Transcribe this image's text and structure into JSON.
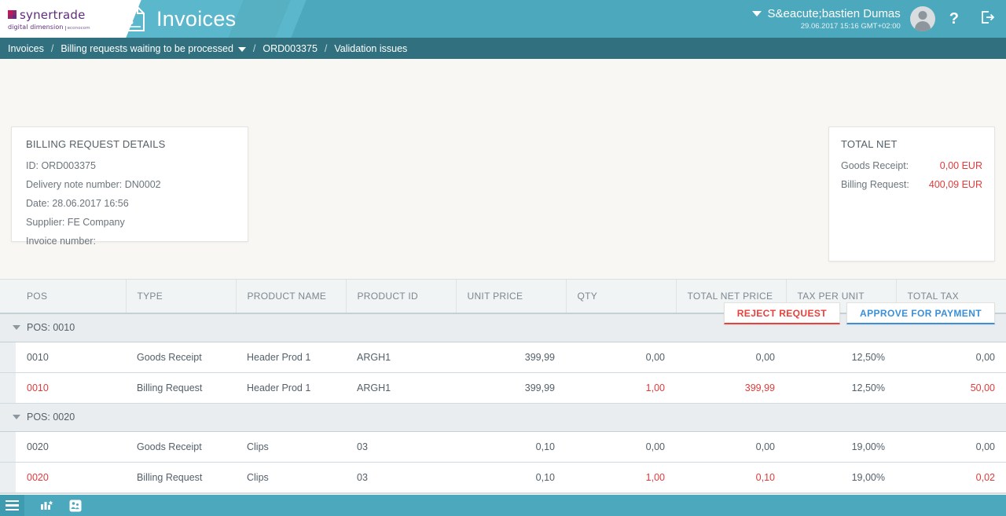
{
  "header": {
    "logo": {
      "word": "synertrade",
      "sub": "digital dimension",
      "eco": "econocom"
    },
    "title": "Invoices",
    "invoice_icon": "invoice-document-icon",
    "user_name": "S&eacute;bastien Dumas",
    "user_time": "29.06.2017 15:16 GMT+02:00",
    "help_label": "?",
    "avatar_icon": "user-avatar-icon",
    "logout_icon": "logout-icon",
    "caret_icon": "chevron-down-icon"
  },
  "breadcrumb": {
    "items": [
      {
        "label": "Invoices",
        "has_caret": false
      },
      {
        "label": "Billing requests waiting to be processed",
        "has_caret": true
      },
      {
        "label": "ORD003375",
        "has_caret": false
      },
      {
        "label": "Validation issues",
        "has_caret": false
      }
    ],
    "separator": "/"
  },
  "details": {
    "title": "BILLING REQUEST DETAILS",
    "lines": [
      "ID: ORD003375",
      "Delivery note number: DN0002",
      "Date: 28.06.2017 16:56",
      "Supplier: FE Company",
      "Invoice number:"
    ]
  },
  "totals": {
    "title": "TOTAL NET",
    "rows": [
      {
        "label": "Goods Receipt:",
        "value": "0,00 EUR"
      },
      {
        "label": "Billing Request:",
        "value": "400,09 EUR"
      }
    ]
  },
  "table": {
    "columns": [
      "POS",
      "TYPE",
      "PRODUCT NAME",
      "PRODUCT ID",
      "UNIT PRICE",
      "QTY",
      "TOTAL NET PRICE",
      "TAX PER UNIT",
      "TOTAL TAX"
    ],
    "groups": [
      {
        "label": "POS: 0010",
        "rows": [
          {
            "pos": "0010",
            "type": "Goods Receipt",
            "product_name": "Header Prod 1",
            "product_id": "ARGH1",
            "unit_price": "399,99",
            "qty": "0,00",
            "total_net_price": "0,00",
            "tax_per_unit": "12,50%",
            "total_tax": "0,00",
            "highlight": false
          },
          {
            "pos": "0010",
            "type": "Billing Request",
            "product_name": "Header Prod 1",
            "product_id": "ARGH1",
            "unit_price": "399,99",
            "qty": "1,00",
            "total_net_price": "399,99",
            "tax_per_unit": "12,50%",
            "total_tax": "50,00",
            "highlight": true
          }
        ]
      },
      {
        "label": "POS: 0020",
        "rows": [
          {
            "pos": "0020",
            "type": "Goods Receipt",
            "product_name": "Clips",
            "product_id": "03",
            "unit_price": "0,10",
            "qty": "0,00",
            "total_net_price": "0,00",
            "tax_per_unit": "19,00%",
            "total_tax": "0,00",
            "highlight": false
          },
          {
            "pos": "0020",
            "type": "Billing Request",
            "product_name": "Clips",
            "product_id": "03",
            "unit_price": "0,10",
            "qty": "1,00",
            "total_net_price": "0,10",
            "tax_per_unit": "19,00%",
            "total_tax": "0,02",
            "highlight": true
          }
        ]
      }
    ]
  },
  "actions": {
    "reject_label": "REJECT REQUEST",
    "approve_label": "APPROVE FOR PAYMENT"
  },
  "footer": {
    "menu_icon": "hamburger-menu-icon",
    "icons": [
      "bar-chart-icon",
      "report-icon"
    ]
  },
  "colors": {
    "header_teal": "#4ba8bd",
    "breadcrumb_teal": "#31717f",
    "accent_red": "#e03b3b",
    "approve_blue": "#3a8fd8",
    "reject_red": "#e8413c",
    "page_bg": "#f8f7f4"
  }
}
